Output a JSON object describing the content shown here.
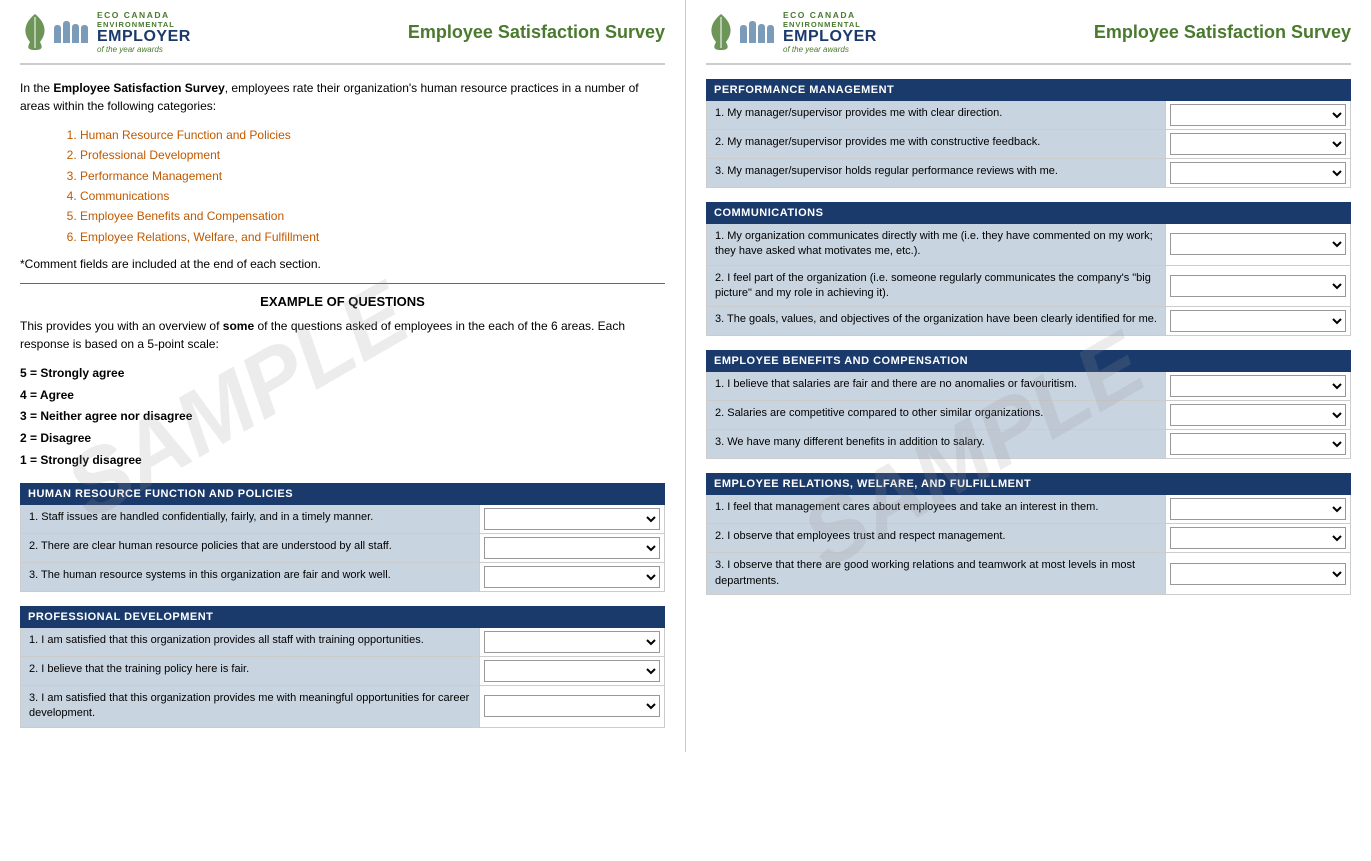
{
  "left_page": {
    "logo": {
      "eco_canada": "ECO CANADA",
      "environmental": "ENVIRONMENTAL",
      "employer": "EMPLOYER",
      "of_year": "of the year awards"
    },
    "survey_title": "Employee Satisfaction Survey",
    "intro": {
      "text_before_bold": "In the ",
      "bold_text": "Employee Satisfaction Survey",
      "text_after": ", employees rate their organization's human resource practices in a number of areas within the following categories:"
    },
    "categories": [
      "Human Resource Function and Policies",
      "Professional Development",
      "Performance Management",
      "Communications",
      "Employee Benefits and Compensation",
      "Employee Relations, Welfare, and Fulfillment"
    ],
    "comment_note": "*Comment fields are included at the end of each section.",
    "example_heading": "EXAMPLE OF QUESTIONS",
    "example_intro_before": "This provides you with an overview of ",
    "example_intro_bold": "some",
    "example_intro_after": " of the questions asked of employees in the each of the 6 areas. Each response is based on a 5-point scale:",
    "scale": [
      "5 = Strongly agree",
      "4 = Agree",
      "3 = Neither agree nor disagree",
      "2 = Disagree",
      "1 = Strongly disagree"
    ],
    "sections": [
      {
        "id": "hr",
        "header": "HUMAN RESOURCE FUNCTION AND POLICIES",
        "questions": [
          "1. Staff issues are handled confidentially, fairly, and in a timely manner.",
          "2. There are clear human resource policies that are understood by all staff.",
          "3. The human resource systems in this organization are fair and work well."
        ]
      },
      {
        "id": "pd",
        "header": "PROFESSIONAL DEVELOPMENT",
        "questions": [
          "1. I am satisfied that this organization provides all staff with training opportunities.",
          "2. I believe that the training policy here is fair.",
          "3. I am satisfied that this organization provides me with meaningful opportunities for career development."
        ]
      }
    ],
    "watermark": "SAMPLE"
  },
  "right_page": {
    "logo": {
      "eco_canada": "ECO CANADA",
      "environmental": "ENVIRONMENTAL",
      "employer": "EMPLOYER",
      "of_year": "of the year awards"
    },
    "survey_title": "Employee Satisfaction Survey",
    "sections": [
      {
        "id": "pm",
        "header": "PERFORMANCE MANAGEMENT",
        "questions": [
          "1. My manager/supervisor provides me with clear direction.",
          "2. My manager/supervisor provides me with constructive feedback.",
          "3. My manager/supervisor holds regular performance reviews with me."
        ]
      },
      {
        "id": "comm",
        "header": "COMMUNICATIONS",
        "questions": [
          "1. My organization communicates directly with me (i.e. they have commented on my work; they have asked what motivates me, etc.).",
          "2. I feel part of the organization (i.e. someone regularly communicates the company's \"big picture\" and my role in achieving it).",
          "3. The goals, values, and objectives of the organization have been clearly identified for me."
        ]
      },
      {
        "id": "ebc",
        "header": "EMPLOYEE BENEFITS AND COMPENSATION",
        "questions": [
          "1. I believe that salaries are fair and there are no anomalies or favouritism.",
          "2. Salaries are competitive compared to other similar organizations.",
          "3. We have many different benefits in addition to salary."
        ]
      },
      {
        "id": "erw",
        "header": "EMPLOYEE RELATIONS, WELFARE, AND FULFILLMENT",
        "questions": [
          "1. I feel that management cares about employees and take an interest in them.",
          "2. I observe that employees trust and respect management.",
          "3. I observe that there are good working relations and teamwork at most levels in most departments."
        ]
      }
    ],
    "watermark": "SAMPLE"
  }
}
